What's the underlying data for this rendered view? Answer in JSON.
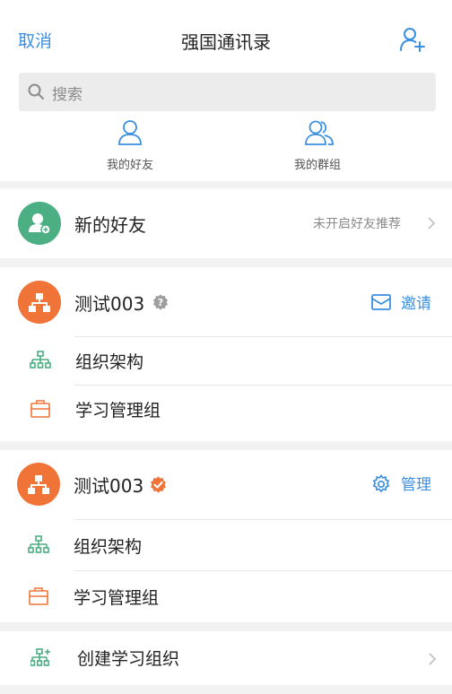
{
  "header": {
    "cancel_label": "取消",
    "title": "强国通讯录"
  },
  "search": {
    "placeholder": "搜索"
  },
  "segments": [
    {
      "label": "我的好友"
    },
    {
      "label": "我的群组"
    }
  ],
  "new_friends": {
    "title": "新的好友",
    "status": "未开启好友推荐"
  },
  "orgs": [
    {
      "name": "测试003",
      "verified": false,
      "action_label": "邀请",
      "action_icon": "mail-icon",
      "rows": [
        {
          "label": "组织架构",
          "icon": "org-chart-icon"
        },
        {
          "label": "学习管理组",
          "icon": "briefcase-icon"
        }
      ]
    },
    {
      "name": "测试003",
      "verified": true,
      "action_label": "管理",
      "action_icon": "gear-icon",
      "rows": [
        {
          "label": "组织架构",
          "icon": "org-chart-icon"
        },
        {
          "label": "学习管理组",
          "icon": "briefcase-icon"
        }
      ]
    }
  ],
  "create": {
    "label": "创建学习组织"
  },
  "colors": {
    "accent": "#3b8fe0",
    "green": "#4cae83",
    "orange": "#f07338",
    "badge_gray": "#9e9e9e"
  }
}
